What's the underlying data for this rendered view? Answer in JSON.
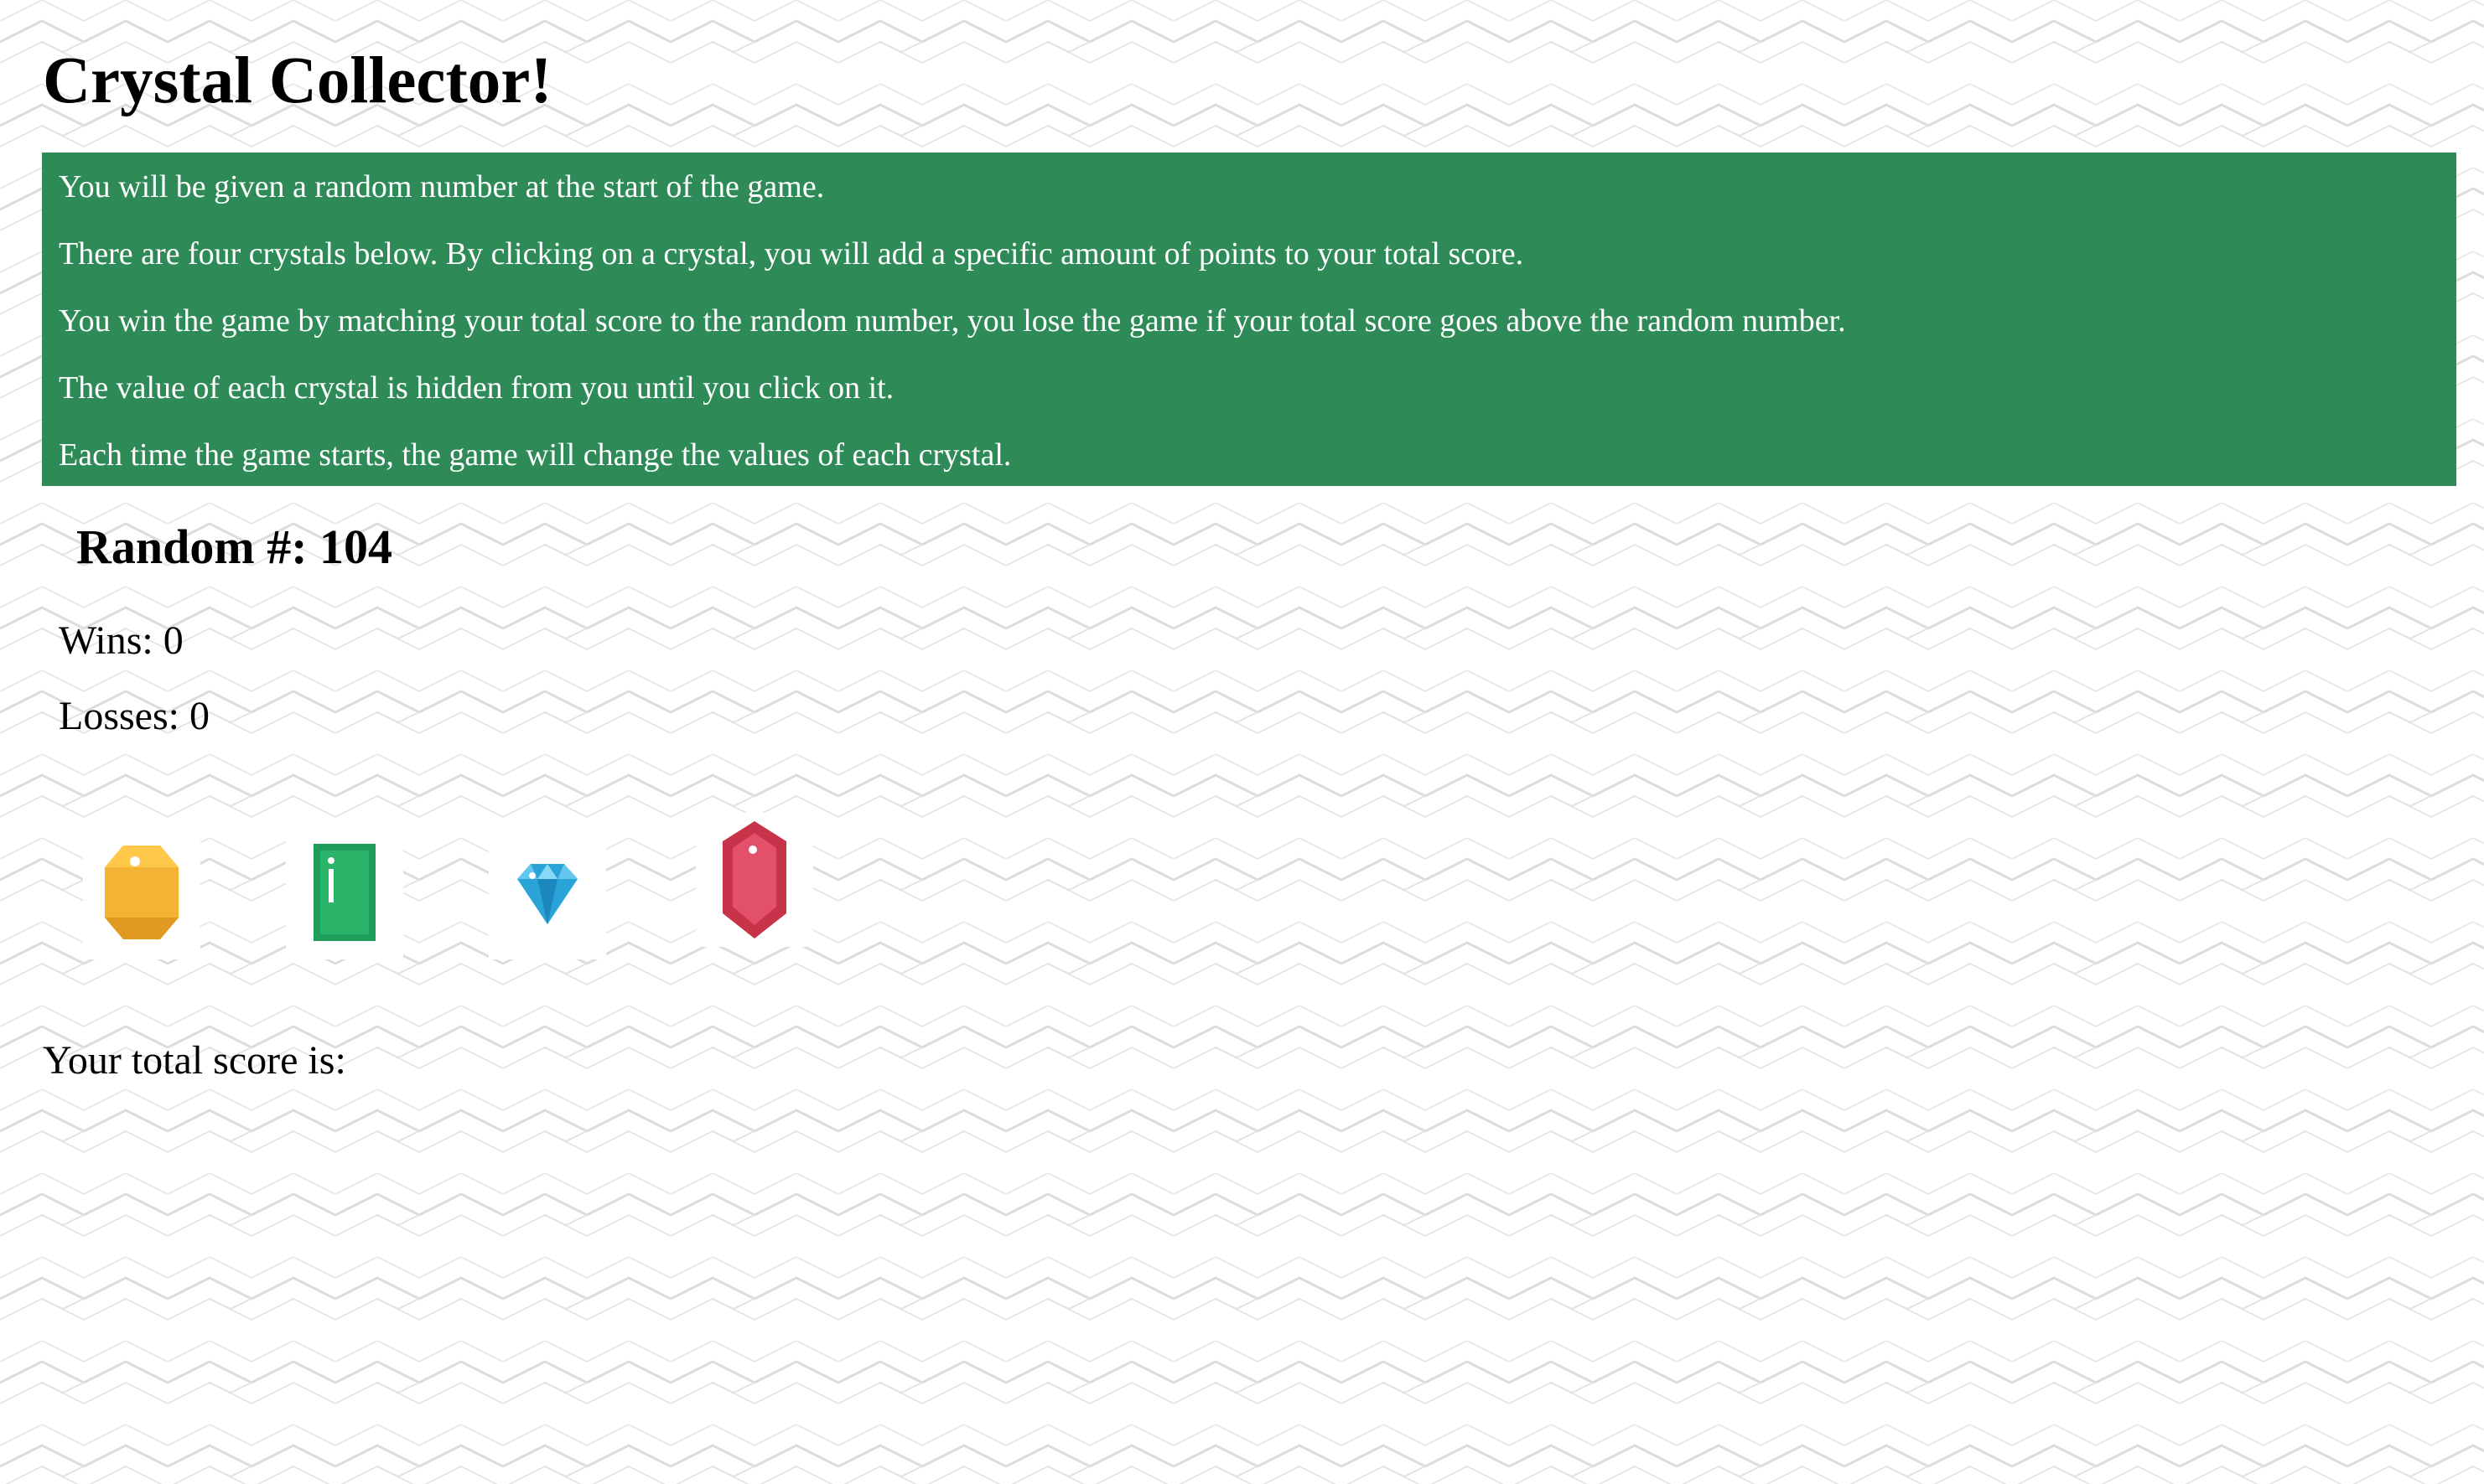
{
  "app": {
    "title": "Crystal Collector!"
  },
  "instructions": [
    "You will be given a random number at the start of the game.",
    "There are four crystals below. By clicking on a crystal, you will add a specific amount of points to your total score.",
    "You win the game by matching your total score to the random number, you lose the game if your total score goes above the random number.",
    "The value of each crystal is hidden from you until you click on it.",
    "Each time the game starts, the game will change the values of each crystal."
  ],
  "game": {
    "random_label": "Random #: 104",
    "wins_label": "Wins: 0",
    "losses_label": "Losses: 0",
    "score_label": "Your total score is:"
  },
  "crystals": [
    {
      "icon": "yellow-octagon-gem-icon",
      "color": "#f5b335"
    },
    {
      "icon": "green-emerald-gem-icon",
      "color": "#1f9e5a"
    },
    {
      "icon": "blue-diamond-gem-icon",
      "color": "#29a3d8"
    },
    {
      "icon": "red-hexagon-gem-icon",
      "color": "#d63e55"
    }
  ],
  "colors": {
    "instructions_bg": "#2e8b57",
    "instructions_text": "#ffffff"
  }
}
